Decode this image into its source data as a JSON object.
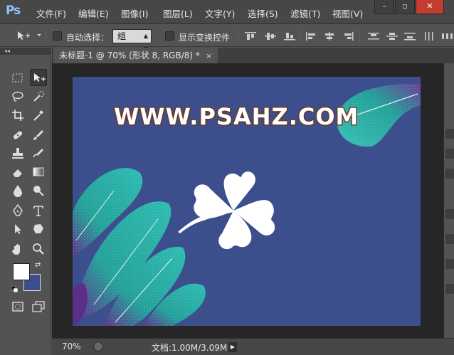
{
  "app": {
    "logo": "Ps"
  },
  "menu": [
    "文件(F)",
    "编辑(E)",
    "图像(I)",
    "图层(L)",
    "文字(Y)",
    "选择(S)",
    "滤镜(T)",
    "视图(V)"
  ],
  "window_controls": {
    "minimize": "–",
    "restore": "▫",
    "close": "✕"
  },
  "options": {
    "auto_select_label": "自动选择：",
    "auto_select_value": "组",
    "show_transform_label": "显示变换控件"
  },
  "toolbar": {
    "collapse": "◂◂"
  },
  "document": {
    "tab_title": "未标题-1 @ 70% (形状 8, RGB/8) *",
    "close": "×",
    "watermark": "WWW.PSAHZ.COM"
  },
  "colors": {
    "canvas_bg": "#3c4f8c",
    "leaf_teal": "#1e9e96",
    "leaf_purple": "#5b2e8a",
    "foreground_swatch": "#ffffff",
    "background_swatch": "#3c4f8c"
  },
  "icons": {
    "tools": [
      "marquee-icon",
      "move-icon",
      "lasso-icon",
      "quick-select-icon",
      "crop-icon",
      "eyedropper-icon",
      "healing-icon",
      "brush-icon",
      "stamp-icon",
      "history-brush-icon",
      "eraser-icon",
      "gradient-icon",
      "blur-icon",
      "dodge-icon",
      "pen-icon",
      "type-icon",
      "path-select-icon",
      "shape-icon",
      "hand-icon",
      "zoom-icon"
    ]
  },
  "status": {
    "zoom": "70%",
    "doc_info": "文档:1.00M/3.09M",
    "arrow": "▶"
  }
}
